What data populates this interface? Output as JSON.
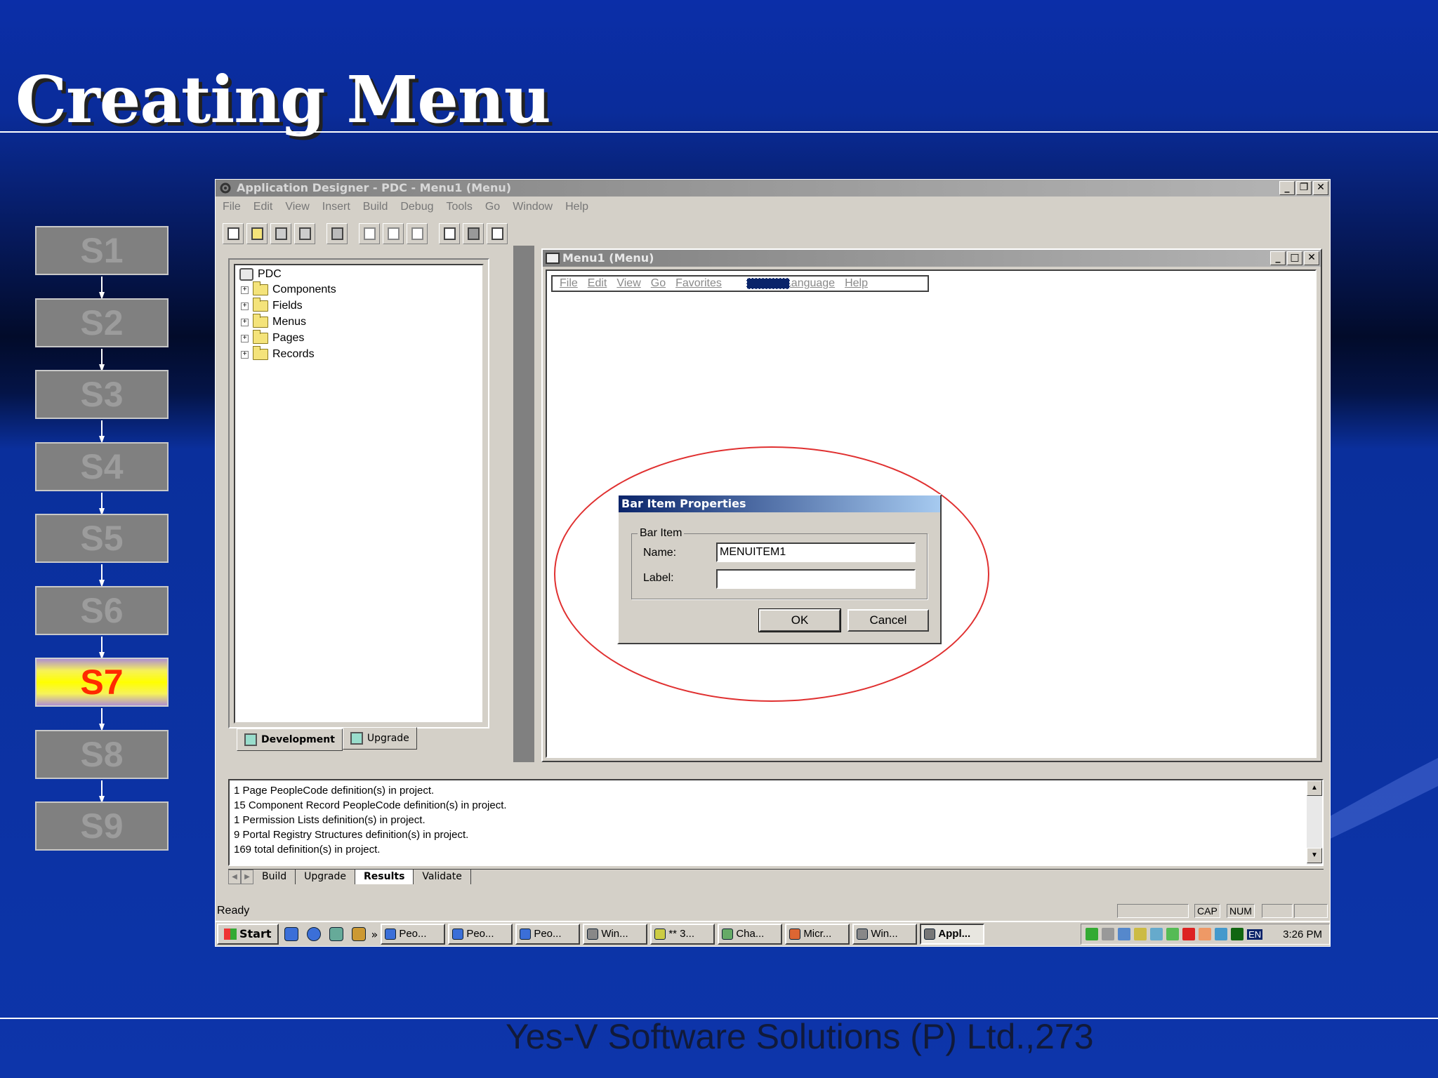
{
  "slide": {
    "title": "Creating Menu",
    "footer": "Yes-V Software Solutions (P) Ltd.,273",
    "steps": [
      "S1",
      "S2",
      "S3",
      "S4",
      "S5",
      "S6",
      "S7",
      "S8",
      "S9"
    ],
    "active_step": "S7"
  },
  "app": {
    "title": "Application Designer - PDC - Menu1 (Menu)",
    "menus": [
      "File",
      "Edit",
      "View",
      "Insert",
      "Build",
      "Debug",
      "Tools",
      "Go",
      "Window",
      "Help"
    ],
    "project": {
      "root": "PDC",
      "items": [
        "Components",
        "Fields",
        "Menus",
        "Pages",
        "Records"
      ],
      "tabs": [
        "Development",
        "Upgrade"
      ]
    },
    "child": {
      "title": "Menu1 (Menu)",
      "menu_preview": [
        "File",
        "Edit",
        "View",
        "Go",
        "Favorites",
        "Language",
        "Help"
      ]
    },
    "dialog": {
      "title": "Bar Item Properties",
      "group": "Bar Item",
      "name_label": "Name:",
      "name_value": "MENUITEM1",
      "label_label": "Label:",
      "label_value": "",
      "ok": "OK",
      "cancel": "Cancel"
    },
    "output": {
      "lines": [
        "1 Page PeopleCode  definition(s) in project.",
        "15 Component Record PeopleCode  definition(s) in project.",
        "1 Permission Lists  definition(s) in project.",
        "9 Portal Registry Structures  definition(s) in project.",
        "169  total definition(s) in project."
      ],
      "tabs": [
        "Build",
        "Upgrade",
        "Results",
        "Validate"
      ]
    },
    "status": {
      "text": "Ready",
      "cap": "CAP",
      "num": "NUM"
    },
    "taskbar": {
      "start": "Start",
      "tasks": [
        "Peo...",
        "Peo...",
        "Peo...",
        "Win...",
        "** 3...",
        "Cha...",
        "Micr...",
        "Win...",
        "Appl..."
      ],
      "lang": "EN",
      "clock": "3:26 PM"
    }
  }
}
